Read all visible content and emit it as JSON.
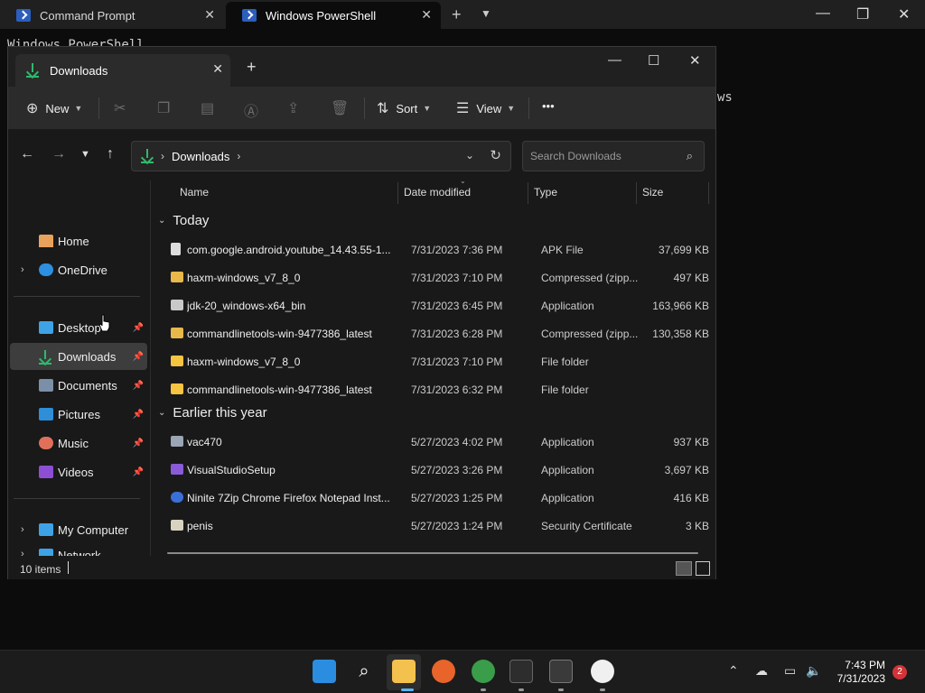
{
  "terminal": {
    "tabs": [
      {
        "label": "Command Prompt"
      },
      {
        "label": "Windows PowerShell"
      }
    ],
    "text_line1": "Windows PowerShell",
    "text_line2": "ws"
  },
  "explorer": {
    "tab_title": "Downloads",
    "toolbar": {
      "new_label": "New",
      "sort_label": "Sort",
      "view_label": "View",
      "more_label": "•••"
    },
    "address": {
      "crumb": "Downloads",
      "search_placeholder": "Search Downloads"
    },
    "sidebar": {
      "items": [
        {
          "label": "Home"
        },
        {
          "label": "OneDrive"
        },
        {
          "label": "Desktop"
        },
        {
          "label": "Downloads"
        },
        {
          "label": "Documents"
        },
        {
          "label": "Pictures"
        },
        {
          "label": "Music"
        },
        {
          "label": "Videos"
        },
        {
          "label": "My Computer"
        },
        {
          "label": "Network"
        }
      ]
    },
    "columns": {
      "name": "Name",
      "date": "Date modified",
      "type": "Type",
      "size": "Size"
    },
    "groups": [
      {
        "label": "Today",
        "files": [
          {
            "name": "com.google.android.youtube_14.43.55-1...",
            "date": "7/31/2023 7:36 PM",
            "type": "APK File",
            "size": "37,699 KB",
            "icon": "document-icon"
          },
          {
            "name": "haxm-windows_v7_8_0",
            "date": "7/31/2023 7:10 PM",
            "type": "Compressed (zipp...",
            "size": "497 KB",
            "icon": "zip-folder-icon"
          },
          {
            "name": "jdk-20_windows-x64_bin",
            "date": "7/31/2023 6:45 PM",
            "type": "Application",
            "size": "163,966 KB",
            "icon": "app-icon"
          },
          {
            "name": "commandlinetools-win-9477386_latest",
            "date": "7/31/2023 6:28 PM",
            "type": "Compressed (zipp...",
            "size": "130,358 KB",
            "icon": "zip-folder-icon"
          },
          {
            "name": "haxm-windows_v7_8_0",
            "date": "7/31/2023 7:10 PM",
            "type": "File folder",
            "size": "",
            "icon": "folder-icon"
          },
          {
            "name": "commandlinetools-win-9477386_latest",
            "date": "7/31/2023 6:32 PM",
            "type": "File folder",
            "size": "",
            "icon": "folder-icon"
          }
        ]
      },
      {
        "label": "Earlier this year",
        "files": [
          {
            "name": "vac470",
            "date": "5/27/2023 4:02 PM",
            "type": "Application",
            "size": "937 KB",
            "icon": "installer-icon"
          },
          {
            "name": "VisualStudioSetup",
            "date": "5/27/2023 3:26 PM",
            "type": "Application",
            "size": "3,697 KB",
            "icon": "visual-studio-icon"
          },
          {
            "name": "Ninite 7Zip Chrome Firefox Notepad Inst...",
            "date": "5/27/2023 1:25 PM",
            "type": "Application",
            "size": "416 KB",
            "icon": "ninite-icon"
          },
          {
            "name": "penis",
            "date": "5/27/2023 1:24 PM",
            "type": "Security Certificate",
            "size": "3 KB",
            "icon": "certificate-icon"
          }
        ]
      }
    ],
    "status": "10 items"
  },
  "taskbar": {
    "time": "7:43 PM",
    "date": "7/31/2023",
    "notification_count": "2"
  }
}
